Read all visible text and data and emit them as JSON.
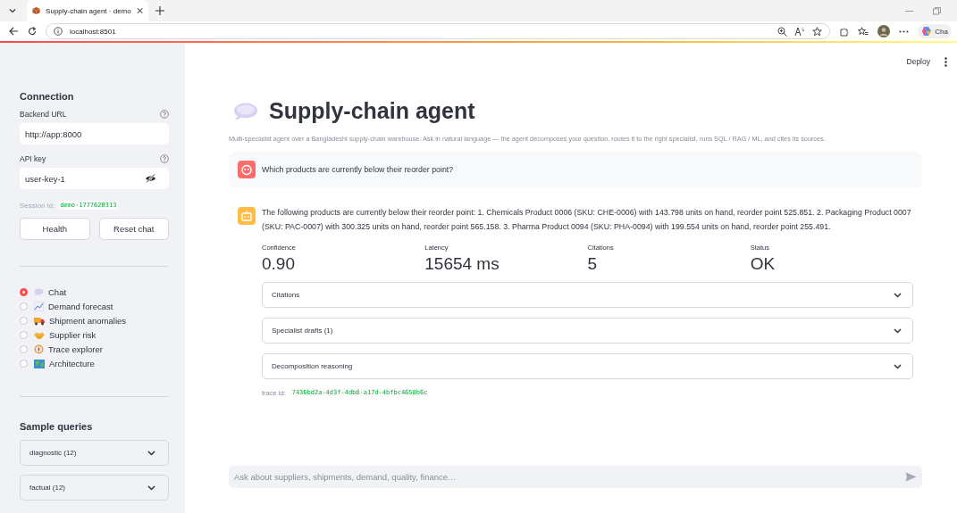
{
  "browser": {
    "tab_title": "Supply-chain agent · demo",
    "address": "localhost:8501",
    "copilot_label": "Cha"
  },
  "header": {
    "deploy": "Deploy"
  },
  "sidebar": {
    "connection_title": "Connection",
    "fields": [
      {
        "label": "Backend URL",
        "value": "http://app:8000",
        "kind": "text"
      },
      {
        "label": "API key",
        "value": "user-key-1",
        "kind": "password"
      }
    ],
    "session_label": "Session id:",
    "session_id": "demo-1777620313",
    "buttons": [
      "Health",
      "Reset chat"
    ],
    "nav": [
      {
        "label": "Chat",
        "selected": true
      },
      {
        "label": "Demand forecast",
        "selected": false
      },
      {
        "label": "Shipment anomalies",
        "selected": false
      },
      {
        "label": "Supplier risk",
        "selected": false
      },
      {
        "label": "Trace explorer",
        "selected": false
      },
      {
        "label": "Architecture",
        "selected": false
      }
    ],
    "samples_title": "Sample queries",
    "samples": [
      {
        "label": "diagnostic (12)",
        "expanded": false
      },
      {
        "label": "factual (12)",
        "expanded": false
      }
    ]
  },
  "main": {
    "title": "Supply-chain agent",
    "subtitle": "Multi-specialist agent over a Bangladeshi supply-chain warehouse. Ask in natural language — the agent decomposes your question, routes it to the right specialist, runs SQL / RAG / ML, and cites its sources.",
    "messages": [
      {
        "kind": "user",
        "text": "Which products are currently below their reorder point?"
      },
      {
        "kind": "assistant",
        "text": "The following products are currently below their reorder point: 1. Chemicals Product 0006 (SKU: CHE-0006) with 143.798 units on hand, reorder point 525.851. 2. Packaging Product 0007 (SKU: PAC-0007) with 300.325 units on hand, reorder point 565.158. 3. Pharma Product 0094 (SKU: PHA-0094) with 199.554 units on hand, reorder point 255.491."
      }
    ],
    "metrics": [
      {
        "label": "Confidence",
        "value": "0.90"
      },
      {
        "label": "Latency",
        "value": "15654 ms"
      },
      {
        "label": "Citations",
        "value": "5"
      },
      {
        "label": "Status",
        "value": "OK"
      }
    ],
    "expanders": [
      {
        "label": "Citations",
        "expanded": false
      },
      {
        "label": "Specialist drafts (1)",
        "expanded": false
      },
      {
        "label": "Decomposition reasoning",
        "expanded": false
      }
    ],
    "trace_label": "trace id:",
    "trace_id": "7436bd2a-4d3f-4db8-a17d-4bfbc4658b6c",
    "chat_placeholder": "Ask about suppliers, shipments, demand, quality, finance…"
  }
}
